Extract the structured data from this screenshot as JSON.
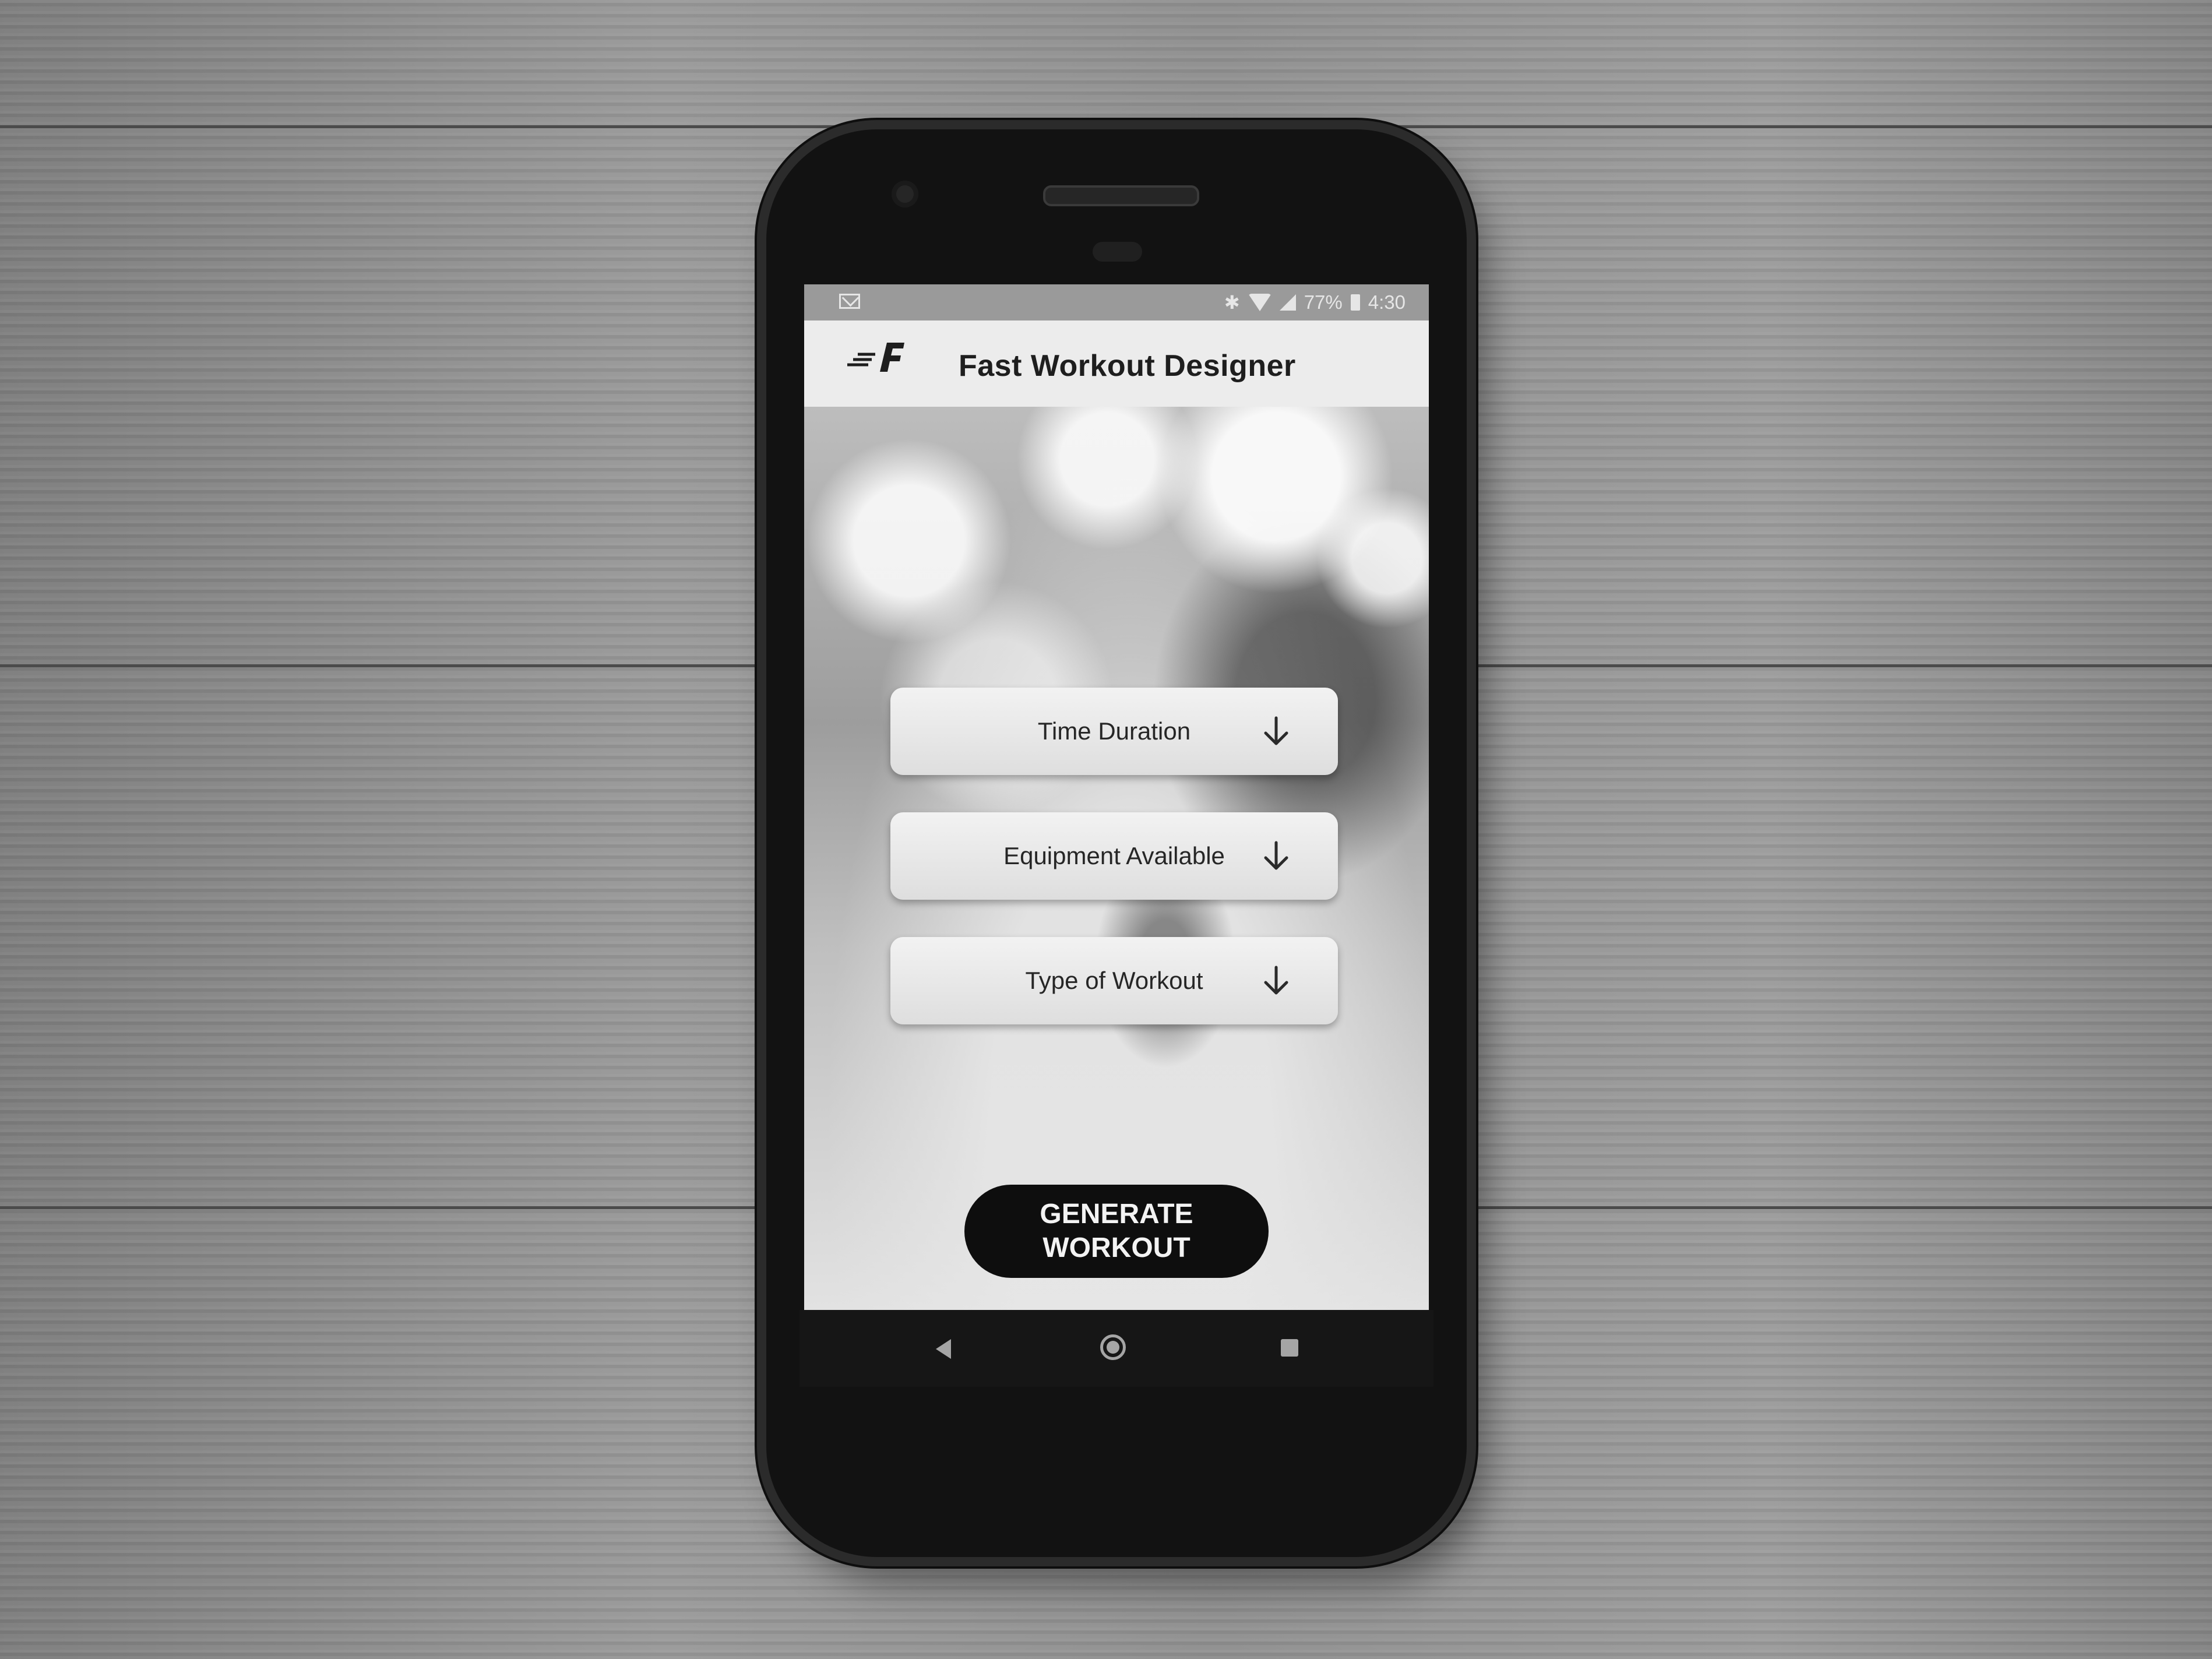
{
  "status_bar": {
    "battery": "77%",
    "time": "4:30",
    "icons": [
      "mail-icon",
      "bluetooth-icon",
      "wifi-icon",
      "signal-icon",
      "battery-icon"
    ]
  },
  "app_bar": {
    "logo_icon": "fast-workout-logo-icon",
    "title": "Fast Workout Designer"
  },
  "selectors": [
    {
      "label": "Time Duration",
      "icon": "arrow-down-icon"
    },
    {
      "label": "Equipment Available",
      "icon": "arrow-down-icon"
    },
    {
      "label": "Type of Workout",
      "icon": "arrow-down-icon"
    }
  ],
  "generate_button": {
    "label": "GENERATE\nWORKOUT"
  },
  "nav_bar": {
    "icons": [
      "back-icon",
      "home-icon",
      "recent-apps-icon"
    ]
  },
  "colors": {
    "app_bar_bg": "#ececec",
    "button_bg": "#0e0e0e",
    "button_text": "#f3f3f3"
  }
}
